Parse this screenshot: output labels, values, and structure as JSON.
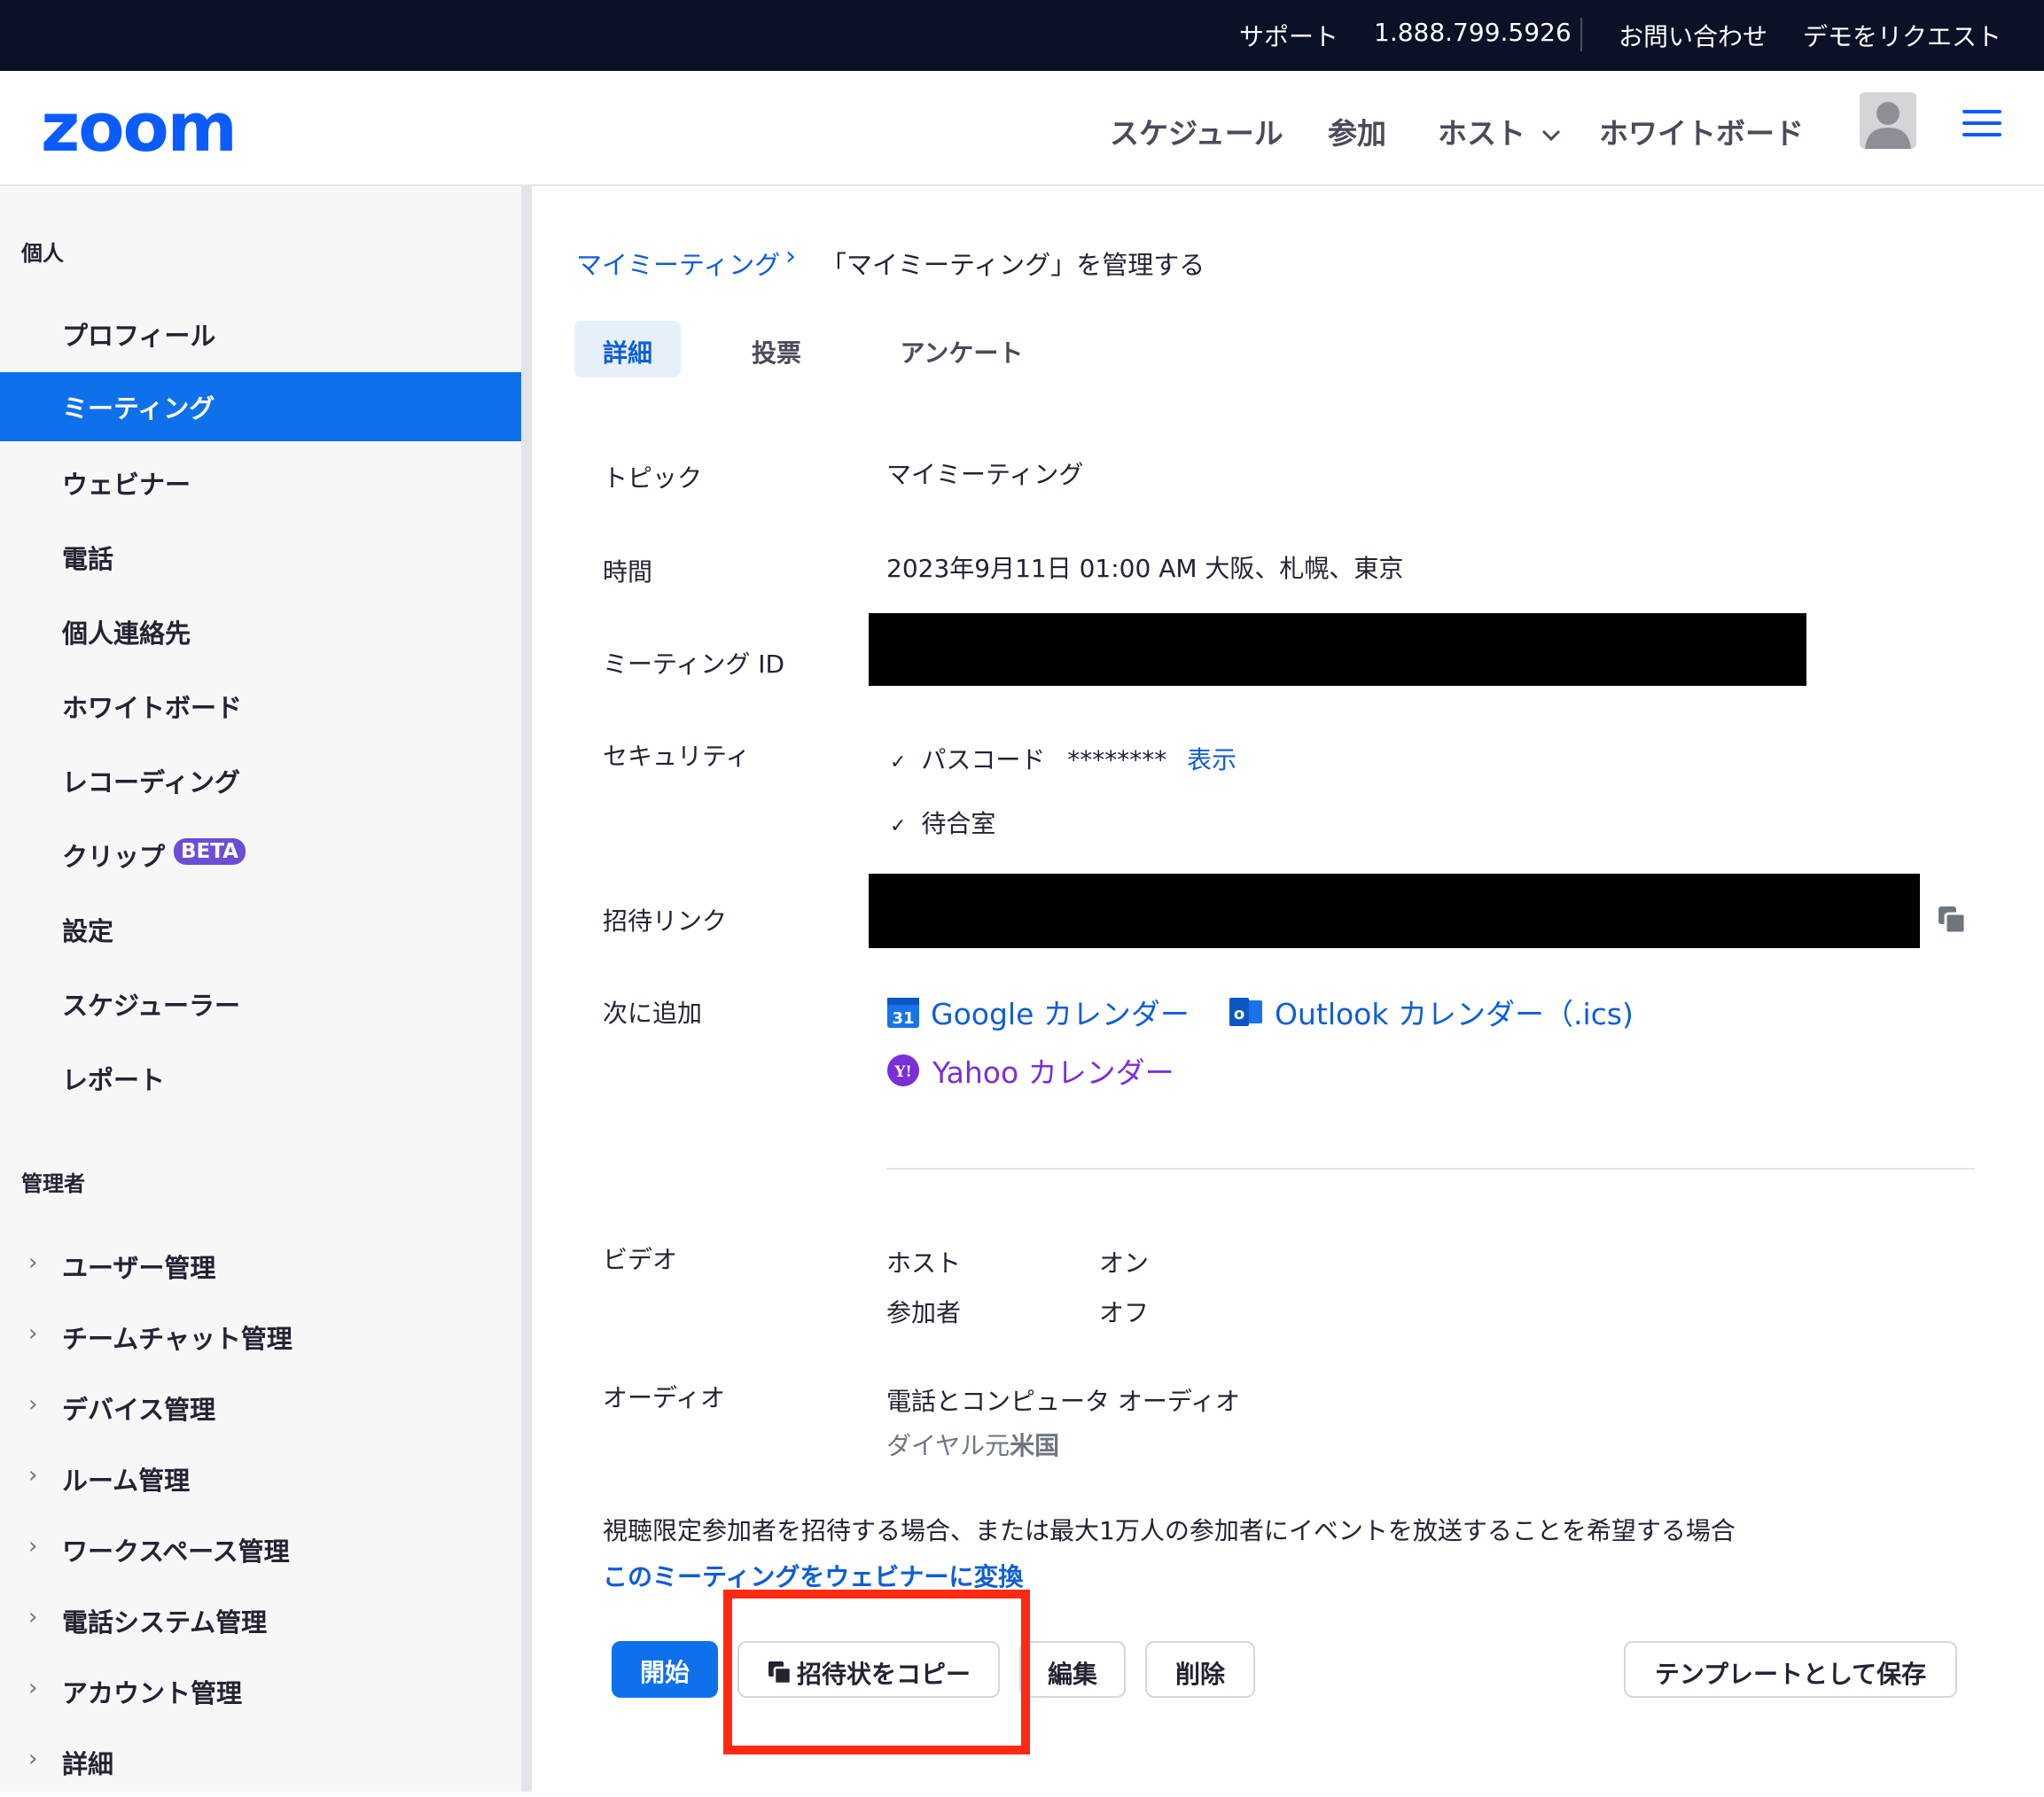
{
  "topbar": {
    "support": "サポート",
    "phone": "1.888.799.5926",
    "contact": "お問い合わせ",
    "demo": "デモをリクエスト"
  },
  "header": {
    "logo": "zoom",
    "nav": {
      "schedule": "スケジュール",
      "join": "参加",
      "host": "ホスト",
      "whiteboard": "ホワイトボード"
    },
    "icons": {
      "avatar": "user-avatar-icon",
      "menu": "hamburger-menu-icon"
    }
  },
  "sidebar": {
    "personal_heading": "個人",
    "personal_items": [
      "プロフィール",
      "ミーティング",
      "ウェビナー",
      "電話",
      "個人連絡先",
      "ホワイトボード",
      "レコーディング",
      "クリップ",
      "設定",
      "スケジューラー",
      "レポート"
    ],
    "active_item": "ミーティング",
    "beta_badge": "BETA",
    "admin_heading": "管理者",
    "admin_items": [
      "ユーザー管理",
      "チームチャット管理",
      "デバイス管理",
      "ルーム管理",
      "ワークスペース管理",
      "電話システム管理",
      "アカウント管理",
      "詳細"
    ]
  },
  "breadcrumb": {
    "parent": "マイミーティング",
    "separator": "›",
    "current": "「マイミーティング」を管理する"
  },
  "tabs": [
    "詳細",
    "投票",
    "アンケート"
  ],
  "details": {
    "topic_label": "トピック",
    "topic_value": "マイミーティング",
    "time_label": "時間",
    "time_value": "2023年9月11日 01:00 AM 大阪、札幌、東京",
    "meeting_id_label": "ミーティング ID",
    "security_label": "セキュリティ",
    "check_mark": "✓",
    "passcode_label": "パスコード",
    "passcode_value": "********",
    "show_link": "表示",
    "waiting_room": "待合室",
    "invite_link_label": "招待リンク",
    "add_to_label": "次に追加",
    "google_calendar": "Google カレンダー",
    "outlook_calendar": "Outlook カレンダー（.ics)",
    "yahoo_calendar": "Yahoo カレンダー",
    "video_label": "ビデオ",
    "video_host": "ホスト",
    "video_host_value": "オン",
    "video_participant": "参加者",
    "video_participant_value": "オフ",
    "audio_label": "オーディオ",
    "audio_value": "電話とコンピュータ オーディオ",
    "dial_in_prefix": "ダイヤル元",
    "dial_in_country": "米国",
    "webinar_note": "視聴限定参加者を招待する場合、または最大1万人の参加者にイベントを放送することを希望する場合",
    "convert_link": "このミーティングをウェビナーに変換"
  },
  "actions": {
    "start": "開始",
    "copy_invitation": "招待状をコピー",
    "edit": "編集",
    "delete": "削除",
    "save_template": "テンプレートとして保存"
  },
  "colors": {
    "brand": "#0b5cff",
    "active_nav": "#0e71eb",
    "link": "#0e5ed6",
    "yahoo": "#7b2fd6",
    "annotation": "#ff2a12"
  }
}
